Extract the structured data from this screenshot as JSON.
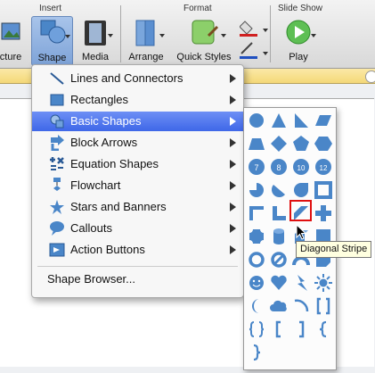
{
  "ribbon": {
    "groups": {
      "insert": "Insert",
      "format": "Format",
      "slideshow": "Slide Show"
    },
    "buttons": {
      "picture": "cture",
      "shape": "Shape",
      "media": "Media",
      "arrange": "Arrange",
      "quick_styles": "Quick Styles",
      "play": "Play"
    }
  },
  "menu": {
    "items": [
      {
        "label": "Lines and Connectors",
        "icon": "line-icon"
      },
      {
        "label": "Rectangles",
        "icon": "rectangle-icon"
      },
      {
        "label": "Basic Shapes",
        "icon": "basic-shapes-icon",
        "selected": true
      },
      {
        "label": "Block Arrows",
        "icon": "block-arrows-icon"
      },
      {
        "label": "Equation Shapes",
        "icon": "equation-shapes-icon"
      },
      {
        "label": "Flowchart",
        "icon": "flowchart-icon"
      },
      {
        "label": "Stars and Banners",
        "icon": "stars-banners-icon"
      },
      {
        "label": "Callouts",
        "icon": "callouts-icon"
      },
      {
        "label": "Action Buttons",
        "icon": "action-buttons-icon"
      }
    ],
    "shape_browser": "Shape Browser..."
  },
  "gallery": {
    "number_shapes": [
      "7",
      "8",
      "10",
      "12"
    ]
  },
  "tooltip": "Diagonal Stripe",
  "colors": {
    "shape_fill": "#4a86c8",
    "highlight": "#e01010",
    "menu_selected": "#3f67e8"
  }
}
